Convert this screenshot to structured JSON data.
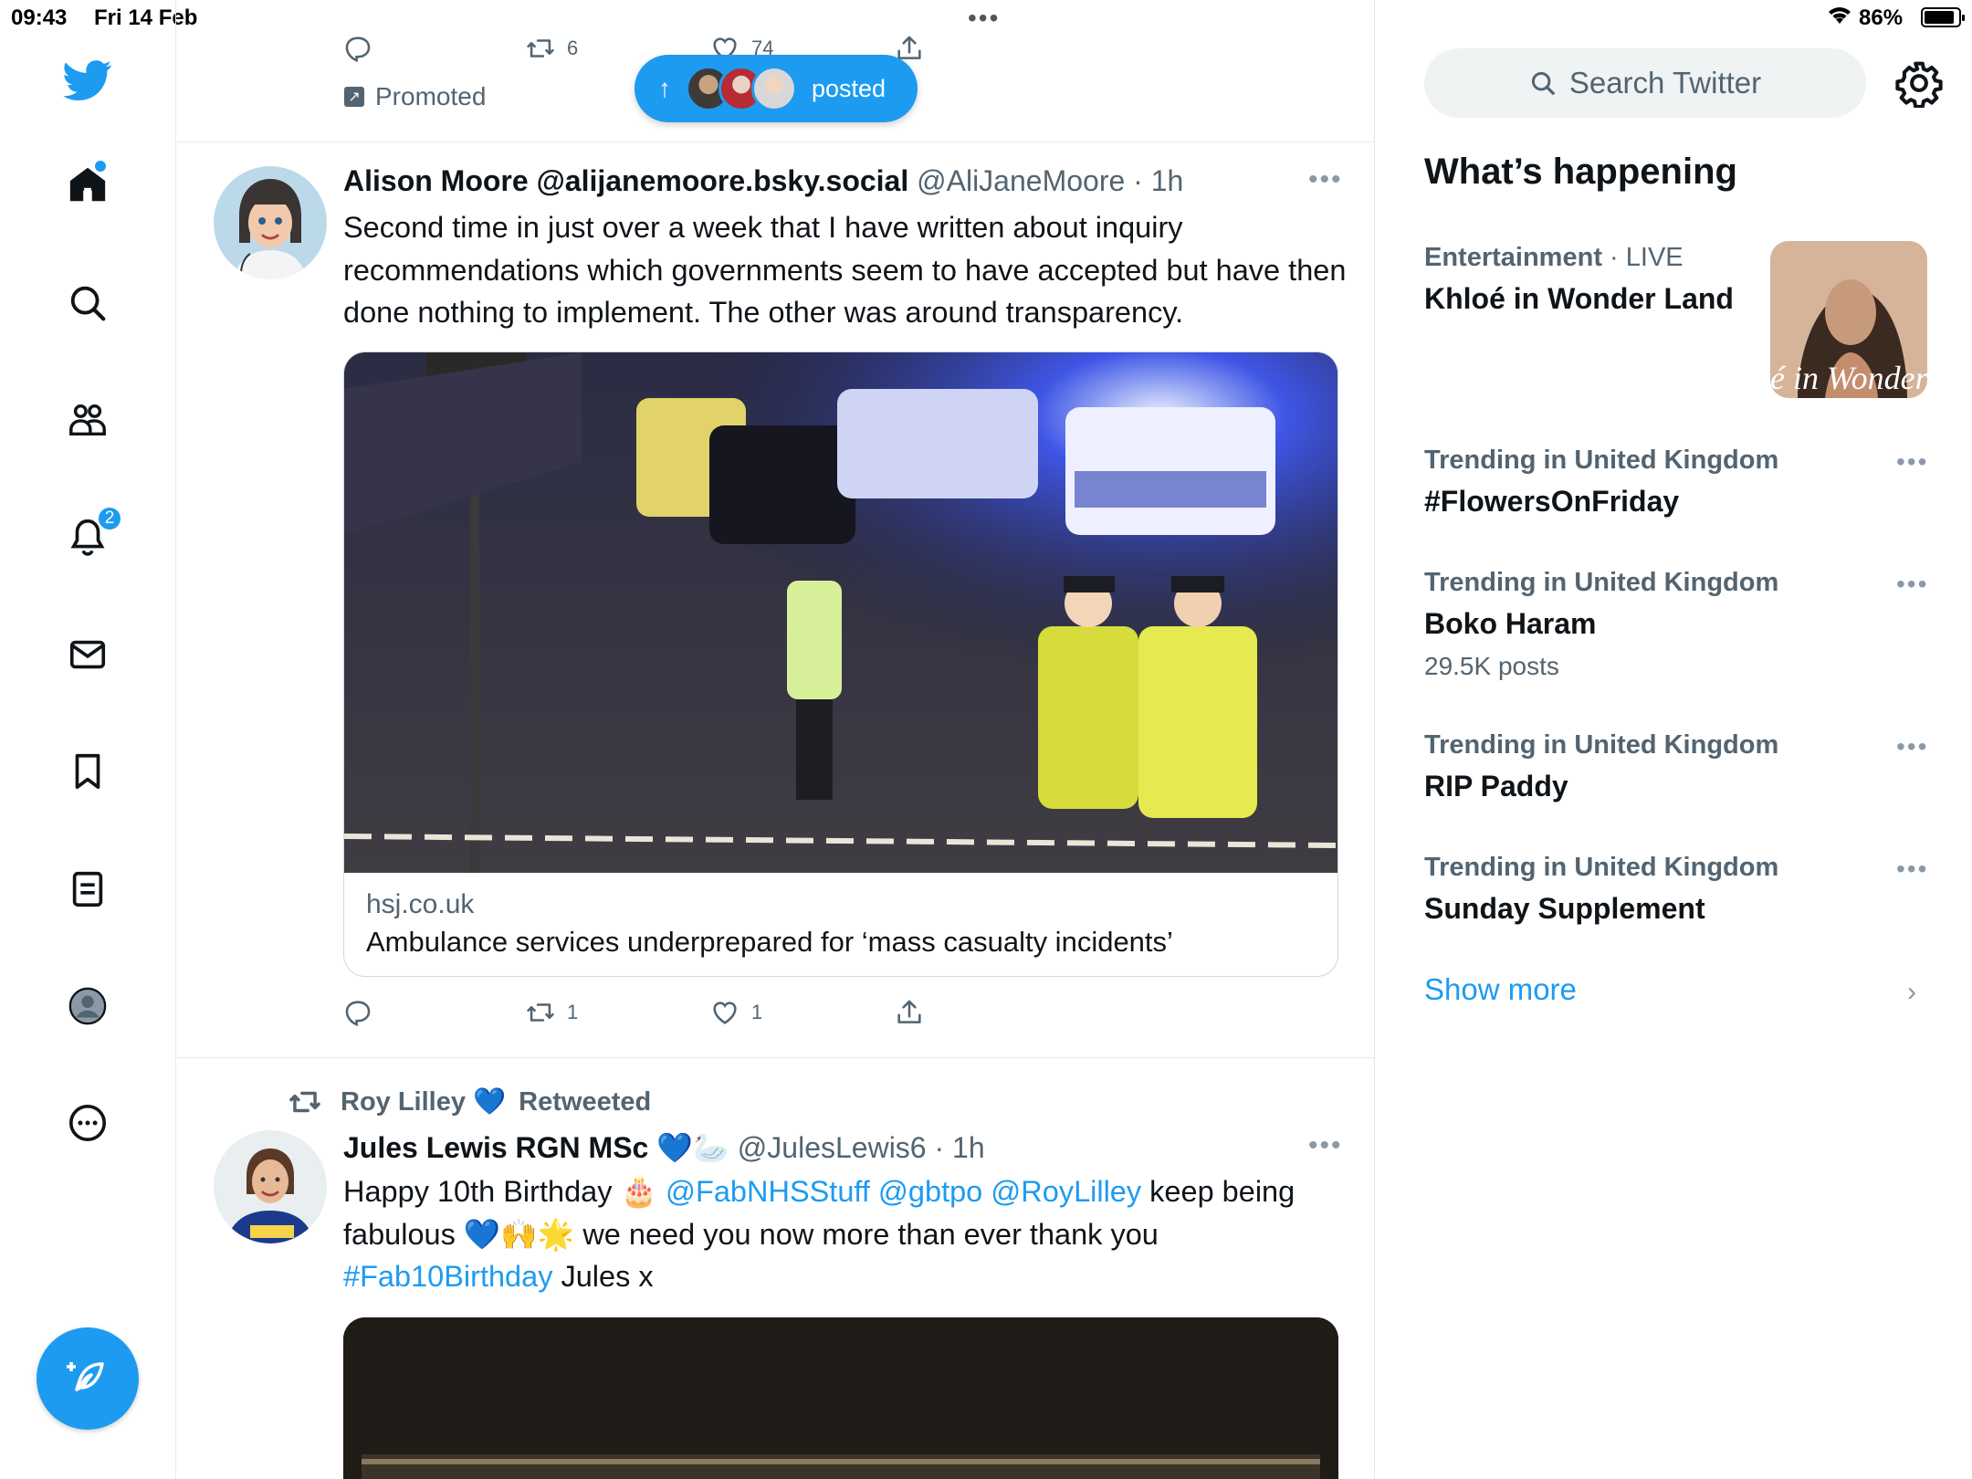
{
  "status_bar": {
    "time": "09:43",
    "date": "Fri 14 Feb",
    "battery": "86%"
  },
  "nav": {
    "notifications_badge": "2"
  },
  "promo_tweet": {
    "retweets": "6",
    "likes": "74",
    "promoted_label": "Promoted"
  },
  "posted_pill": {
    "label": "posted"
  },
  "tweet1": {
    "name": "Alison Moore @alijanemoore.bsky.social",
    "handle": "@AliJaneMoore",
    "time": "· 1h",
    "text": "Second time in just over a week that I have written about inquiry recommendations which governments seem to have accepted but have then done nothing to implement. The other was around transparency.",
    "card_domain": "hsj.co.uk",
    "card_title": "Ambulance services underprepared for ‘mass casualty incidents’",
    "retweets": "1",
    "likes": "1"
  },
  "tweet2": {
    "retweeted_by": "Roy Lilley 💙",
    "retweeted_label": "Retweeted",
    "name": "Jules Lewis RGN MSc 💙🦢",
    "handle": "@JulesLewis6",
    "time": "· 1h",
    "text_1": "Happy 10th Birthday 🎂 ",
    "mention_1": "@FabNHSStuff",
    "mention_2": "@gbtpo",
    "mention_3": "@RoyLilley",
    "text_2": " keep being fabulous 💙🙌🌟 we need you now more than ever thank you ",
    "hashtag": "#Fab10Birthday",
    "text_3": " Jules x"
  },
  "sidebar": {
    "search_placeholder": "Search Twitter",
    "whats_happening": "What’s happening",
    "trends": [
      {
        "category": "Entertainment",
        "live": " · LIVE",
        "topic": "Khloé in Wonder Land",
        "count": ""
      },
      {
        "category": "Trending in United Kingdom",
        "topic": "#FlowersOnFriday",
        "count": ""
      },
      {
        "category": "Trending in United Kingdom",
        "topic": "Boko Haram",
        "count": "29.5K posts"
      },
      {
        "category": "Trending in United Kingdom",
        "topic": "RIP Paddy",
        "count": ""
      },
      {
        "category": "Trending in United Kingdom",
        "topic": "Sunday Supplement",
        "count": ""
      }
    ],
    "trend_image_caption": "é in Wonder l",
    "show_more": "Show more"
  },
  "colors": {
    "accent": "#1d9bf0",
    "text": "#0f1419",
    "secondary": "#536471",
    "border": "#e7e9ea"
  }
}
